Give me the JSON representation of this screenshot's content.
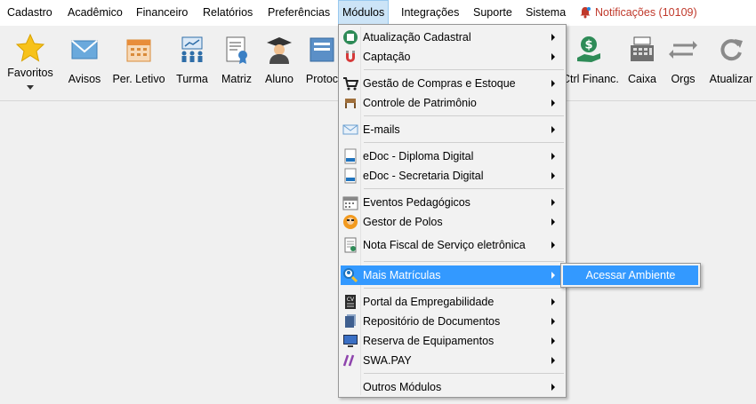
{
  "menubar": {
    "items": [
      "Cadastro",
      "Acadêmico",
      "Financeiro",
      "Relatórios",
      "Preferências",
      "Módulos",
      "Integrações",
      "Suporte",
      "Sistema"
    ],
    "active": "Módulos",
    "notifications": "Notificações (10109)"
  },
  "toolbar": {
    "favorites": "Favoritos",
    "buttons": [
      "Avisos",
      "Per. Letivo",
      "Turma",
      "Matriz",
      "Aluno",
      "Protoc",
      "Ctrl Financ.",
      "Caixa",
      "Orgs",
      "Atualizar"
    ]
  },
  "modules_menu": {
    "items": [
      "Atualização Cadastral",
      "Captação",
      "Gestão de Compras e Estoque",
      "Controle de Patrimônio",
      "E-mails",
      "eDoc - Diploma Digital",
      "eDoc - Secretaria Digital",
      "Eventos Pedagógicos",
      "Gestor de Polos",
      "Nota Fiscal de Serviço eletrônica",
      "Mais Matrículas",
      "Portal da Empregabilidade",
      "Repositório de Documentos",
      "Reserva de Equipamentos",
      "SWA.PAY",
      "Outros Módulos"
    ],
    "highlighted": "Mais Matrículas"
  },
  "submenu": {
    "items": [
      "Acessar Ambiente"
    ]
  },
  "colors": {
    "highlight": "#3399ff",
    "notification": "#c0392b",
    "active_menu_bg": "#cce4f7"
  }
}
